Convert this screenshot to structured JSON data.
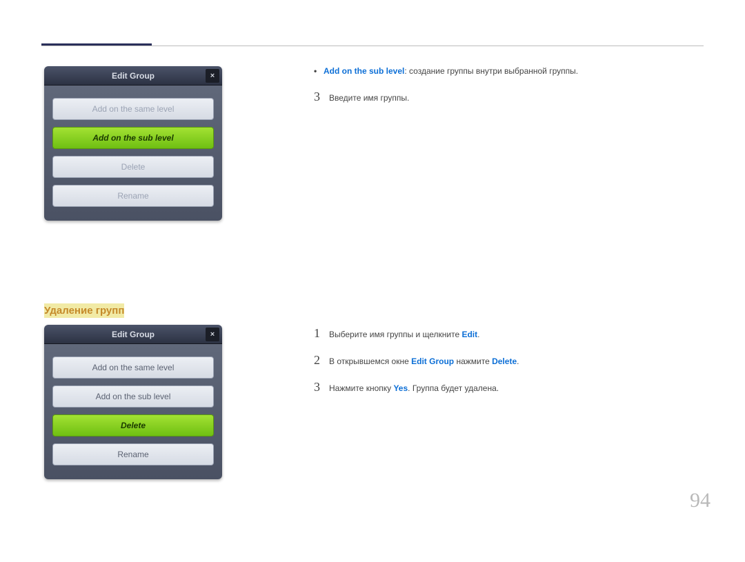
{
  "page_number": "94",
  "dialog1": {
    "title": "Edit Group",
    "close": "×",
    "opt_same": "Add on the same level",
    "opt_sub": "Add on the sub level",
    "opt_delete": "Delete",
    "opt_rename": "Rename"
  },
  "section2_title": "Удаление групп",
  "dialog2": {
    "title": "Edit Group",
    "close": "×",
    "opt_same": "Add on the same level",
    "opt_sub": "Add on the sub level",
    "opt_delete": "Delete",
    "opt_rename": "Rename"
  },
  "top_text": {
    "bullet_dot": "•",
    "bullet_keyword": "Add on the sub level",
    "bullet_body": ": создание группы внутри выбранной группы.",
    "step3_num": "3",
    "step3_body": "Введите имя группы."
  },
  "del_steps": {
    "s1_num": "1",
    "s1_a": "Выберите имя группы и щелкните ",
    "s1_k": "Edit",
    "s1_b": ".",
    "s2_num": "2",
    "s2_a": "В открывшемся окне ",
    "s2_k1": "Edit Group",
    "s2_b": " нажмите ",
    "s2_k2": "Delete",
    "s2_c": ".",
    "s3_num": "3",
    "s3_a": "Нажмите кнопку ",
    "s3_k": "Yes",
    "s3_b": ". Группа будет удалена."
  }
}
